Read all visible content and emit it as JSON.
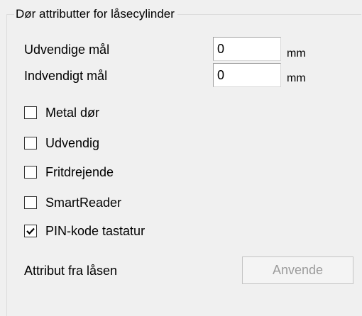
{
  "group": {
    "title": "Dør attributter for låsecylinder"
  },
  "fields": [
    {
      "label": "Udvendige mål",
      "value": "0",
      "unit": "mm"
    },
    {
      "label": "Indvendigt mål",
      "value": "0",
      "unit": "mm"
    }
  ],
  "checkboxes": [
    {
      "label": "Metal dør",
      "checked": false
    },
    {
      "label": "Udvendig",
      "checked": false
    },
    {
      "label": "Fritdrejende",
      "checked": false
    },
    {
      "label": "SmartReader",
      "checked": false
    },
    {
      "label": "PIN-kode tastatur",
      "checked": true
    }
  ],
  "attribute": {
    "label": "Attribut fra låsen",
    "button_label": "Anvende",
    "button_enabled": false
  },
  "colors": {
    "background": "#f0f0f0",
    "disabled_text": "#9b9b9b"
  },
  "icons": {
    "checkmark": "checkmark-icon"
  }
}
